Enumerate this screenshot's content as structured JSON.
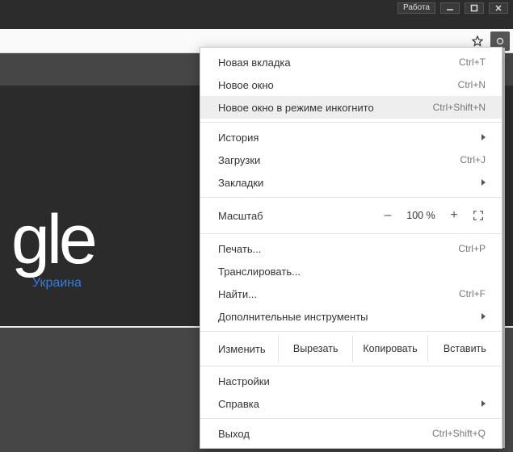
{
  "titlebar": {
    "profile_label": "Работа"
  },
  "page": {
    "logo_fragment": "gle",
    "region": "Украина"
  },
  "menu": {
    "new_tab": {
      "label": "Новая вкладка",
      "shortcut": "Ctrl+T"
    },
    "new_window": {
      "label": "Новое окно",
      "shortcut": "Ctrl+N"
    },
    "incognito": {
      "label": "Новое окно в режиме инкогнито",
      "shortcut": "Ctrl+Shift+N"
    },
    "history": {
      "label": "История"
    },
    "downloads": {
      "label": "Загрузки",
      "shortcut": "Ctrl+J"
    },
    "bookmarks": {
      "label": "Закладки"
    },
    "zoom": {
      "label": "Масштаб",
      "value": "100 %",
      "minus": "–",
      "plus": "+"
    },
    "print": {
      "label": "Печать...",
      "shortcut": "Ctrl+P"
    },
    "cast": {
      "label": "Транслировать..."
    },
    "find": {
      "label": "Найти...",
      "shortcut": "Ctrl+F"
    },
    "tools": {
      "label": "Дополнительные инструменты"
    },
    "edit": {
      "label": "Изменить",
      "cut": "Вырезать",
      "copy": "Копировать",
      "paste": "Вставить"
    },
    "settings": {
      "label": "Настройки"
    },
    "help": {
      "label": "Справка"
    },
    "exit": {
      "label": "Выход",
      "shortcut": "Ctrl+Shift+Q"
    }
  }
}
